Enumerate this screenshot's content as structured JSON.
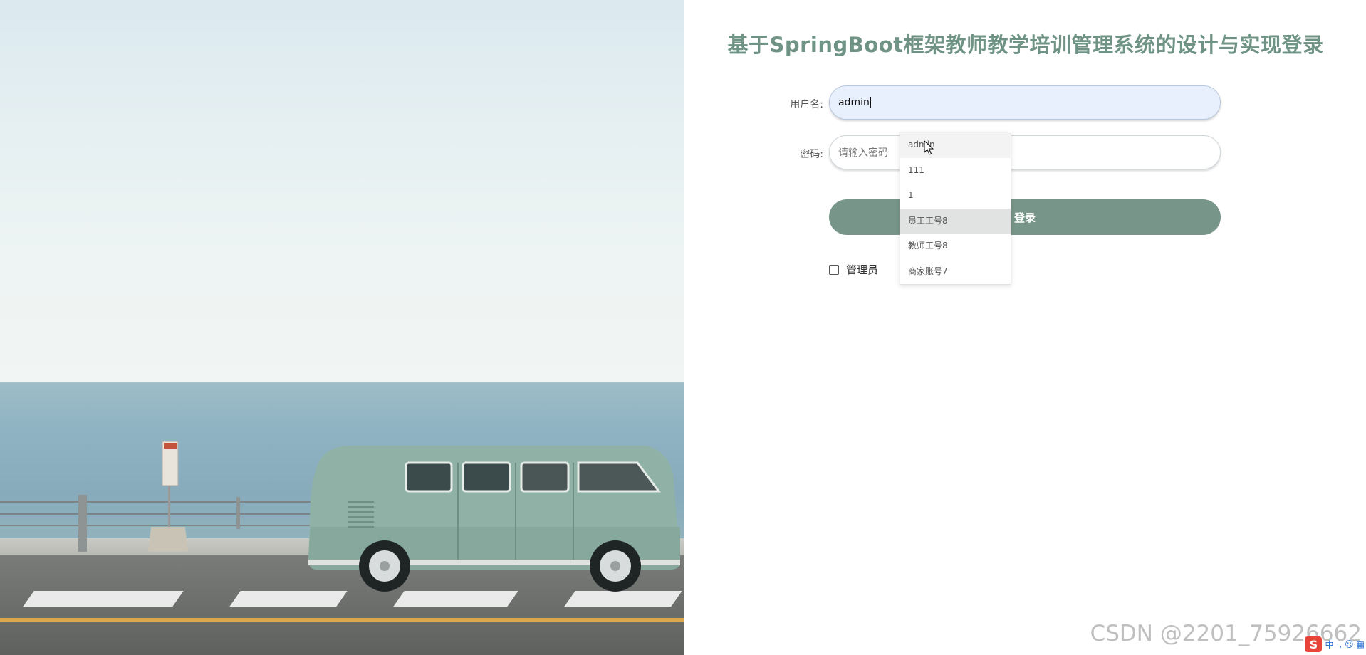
{
  "login": {
    "title": "基于SpringBoot框架教师教学培训管理系统的设计与实现登录",
    "username_label": "用户名:",
    "username_value": "admin",
    "password_label": "密码:",
    "password_placeholder": "请输入密码",
    "login_button": "登录",
    "role_admin_label": "管理员"
  },
  "autocomplete": {
    "items": [
      "admin",
      "111",
      "1",
      "员工工号8",
      "教师工号8",
      "商家账号7"
    ]
  },
  "watermark": "CSDN @2201_75926662",
  "ime": {
    "logo": "S",
    "mode": "中",
    "punct": "·,",
    "icons": [
      "emoji-icon",
      "keyboard-icon"
    ]
  },
  "colors": {
    "title": "#6f9485",
    "login_button": "#779689",
    "username_autofill_bg": "#e8f0fe"
  }
}
